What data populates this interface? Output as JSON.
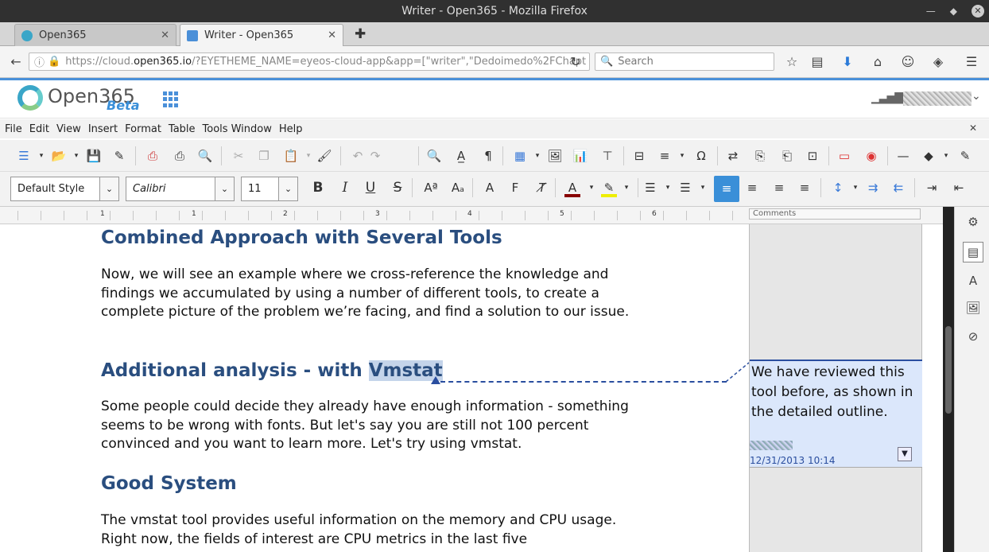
{
  "window": {
    "title": "Writer - Open365 - Mozilla Firefox"
  },
  "tabs": [
    {
      "label": "Open365",
      "active": false
    },
    {
      "label": "Writer - Open365",
      "active": true
    }
  ],
  "nav": {
    "url_prefix": "https://cloud.",
    "url_domain": "open365.io",
    "url_rest": "/?EYETHEME_NAME=eyeos-cloud-app&app=[\"writer\",\"Dedoimedo%2FChapt",
    "search_placeholder": "Search"
  },
  "app": {
    "logo_text": "Open365",
    "beta_label": "Beta"
  },
  "menu": {
    "items": [
      "File",
      "Edit",
      "View",
      "Insert",
      "Format",
      "Table",
      "Tools",
      "Window",
      "Help"
    ]
  },
  "format": {
    "style": "Default Style",
    "font": "Calibri",
    "size": "11"
  },
  "ruler": {
    "comments_label": "Comments",
    "numbers": [
      "1",
      "1",
      "2",
      "3",
      "4",
      "5",
      "6"
    ]
  },
  "document": {
    "heading1": "Combined Approach with Several Tools",
    "para1": "Now, we will see an example where we cross-reference the knowledge and findings we accumulated by using a number of different tools, to create a complete picture of the problem we’re facing, and find a solution to our issue.",
    "heading2_prefix": "Additional analysis - with ",
    "heading2_highlight": "Vmstat",
    "para2": "Some people could decide they already have enough information - something seems to be wrong with fonts. But let's say you are still not 100 percent convinced and you want to learn more. Let's try using vmstat.",
    "heading3": "Good System",
    "para3": "The vmstat tool provides useful information on the memory and CPU usage. Right now, the fields of interest are CPU metrics in the last five"
  },
  "comment": {
    "text": "We have reviewed this tool before, as shown in the detailed outline.",
    "date": "12/31/2013 10:14"
  },
  "colors": {
    "accent": "#3a8fd8",
    "heading": "#2a4e7f",
    "comment_bg": "#dbe7fb"
  }
}
